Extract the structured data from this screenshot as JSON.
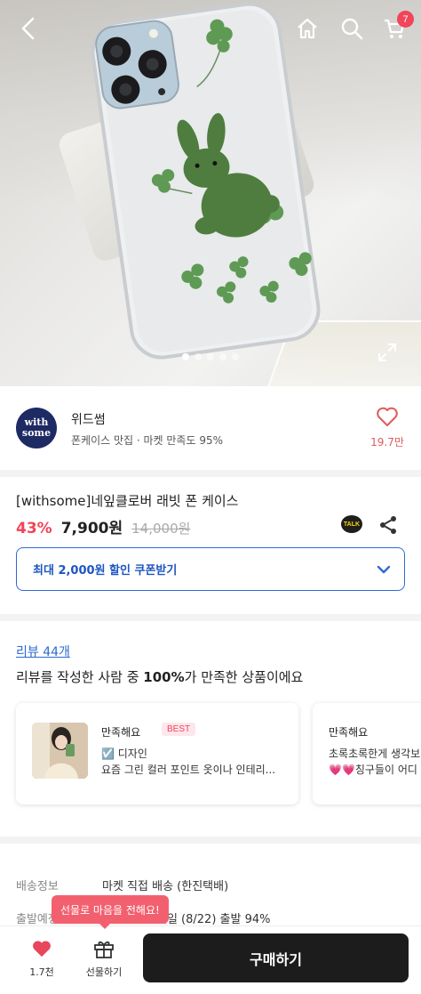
{
  "header": {
    "back_icon": "chevron-left-icon",
    "home_icon": "home-icon",
    "search_icon": "search-icon",
    "cart_icon": "cart-icon",
    "cart_count": "7"
  },
  "gallery": {
    "expand_icon": "expand-icon",
    "page_indicator": {
      "current": 1,
      "total": 5
    }
  },
  "seller": {
    "logo_text": "with some",
    "name": "위드썸",
    "meta": "폰케이스 맛집 · 마켓 만족도 95%",
    "like_count": "19.7만"
  },
  "product": {
    "title": "[withsome]네잎클로버 래빗 폰 케이스",
    "discount": "43%",
    "price": "7,900원",
    "original_price": "14,000원",
    "talk_label": "TALK",
    "coupon_label": "최대 2,000원 할인 쿠폰받기"
  },
  "reviews": {
    "count_link": "리뷰 44개",
    "summary_prefix": "리뷰를 작성한 사람 중 ",
    "summary_bold": "100%",
    "summary_suffix": "가 만족한 상품이에요",
    "cards": [
      {
        "rating": "만족해요",
        "badge": "BEST",
        "line1": "☑️ 디자인",
        "line2": "요즘 그린 컬러 포인트 옷이나 인테리..."
      },
      {
        "rating": "만족해요",
        "line1": "초록초록한게 생각보",
        "line2": "💗💗칭구들이 어디"
      }
    ]
  },
  "delivery": {
    "rows": [
      {
        "label": "배송정보",
        "value": "마켓 직접 배송 (한진택배)"
      },
      {
        "label": "출발예정",
        "value": "내일 (8/22) 출발 94%"
      }
    ]
  },
  "bottom_bar": {
    "like_count": "1.7천",
    "gift_label": "선물하기",
    "gift_tooltip": "선물로 마음을 전해요!",
    "buy_label": "구매하기"
  },
  "colors": {
    "accent_red": "#f0455a",
    "accent_blue": "#2d6bd3",
    "buy_button": "#1c1c1c",
    "seller_logo_bg": "#1d2a63"
  }
}
